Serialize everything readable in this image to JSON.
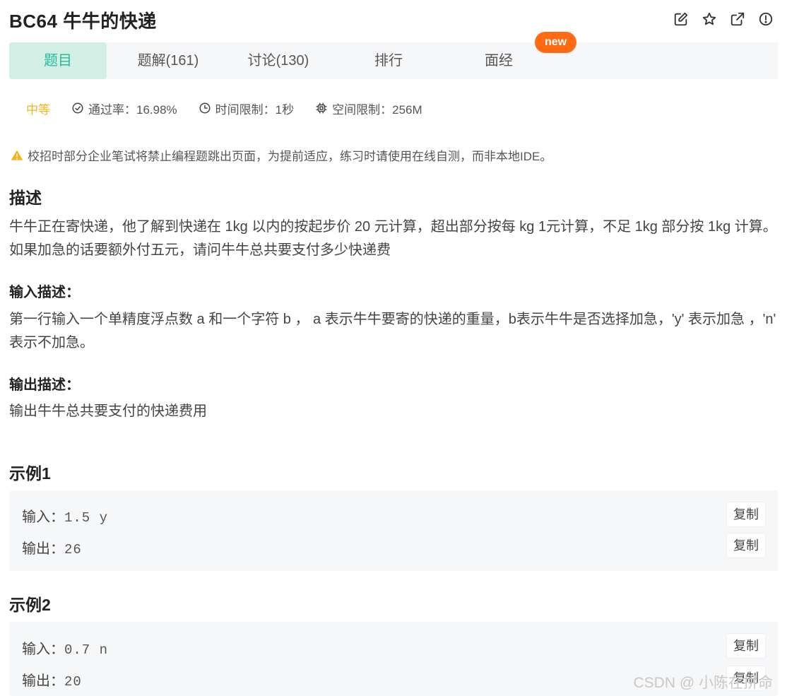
{
  "header": {
    "title": "BC64  牛牛的快递",
    "actions": [
      "edit-icon",
      "star-icon",
      "external-link-icon",
      "alert-icon"
    ]
  },
  "tabs": {
    "items": [
      {
        "label": "题目",
        "active": true
      },
      {
        "label": "题解(161)"
      },
      {
        "label": "讨论(130)"
      },
      {
        "label": "排行"
      },
      {
        "label": "面经"
      }
    ],
    "badge": "new"
  },
  "meta": {
    "difficulty": "中等",
    "pass_rate": "通过率：16.98%",
    "time_limit": "时间限制：1秒",
    "memory_limit": "空间限制：256M"
  },
  "notice": "校招时部分企业笔试将禁止编程题跳出页面，为提前适应，练习时请使用在线自测，而非本地IDE。",
  "description": {
    "heading": "描述",
    "text": "牛牛正在寄快递，他了解到快递在 1kg 以内的按起步价 20 元计算，超出部分按每 kg 1元计算，不足 1kg 部分按 1kg 计算。如果加急的话要额外付五元，请问牛牛总共要支付多少快递费"
  },
  "input_desc": {
    "heading": "输入描述：",
    "text": "第一行输入一个单精度浮点数 a 和一个字符 b ， a 表示牛牛要寄的快递的重量，b表示牛牛是否选择加急，'y' 表示加急 ，'n' 表示不加急。"
  },
  "output_desc": {
    "heading": "输出描述：",
    "text": "输出牛牛总共要支付的快递费用"
  },
  "examples": [
    {
      "heading": "示例1",
      "input_label": "输入：",
      "input": "1.5 y",
      "output_label": "输出：",
      "output": "26",
      "copy": "复制"
    },
    {
      "heading": "示例2",
      "input_label": "输入：",
      "input": "0.7 n",
      "output_label": "输出：",
      "output": "20",
      "copy": "复制"
    }
  ],
  "watermark": "CSDN @ 小陈在拼命",
  "colors": {
    "accent": "#25bb9b",
    "tab_active_bg": "#d3efe5",
    "difficulty": "#f5b41c",
    "badge": "#ff6a13"
  }
}
